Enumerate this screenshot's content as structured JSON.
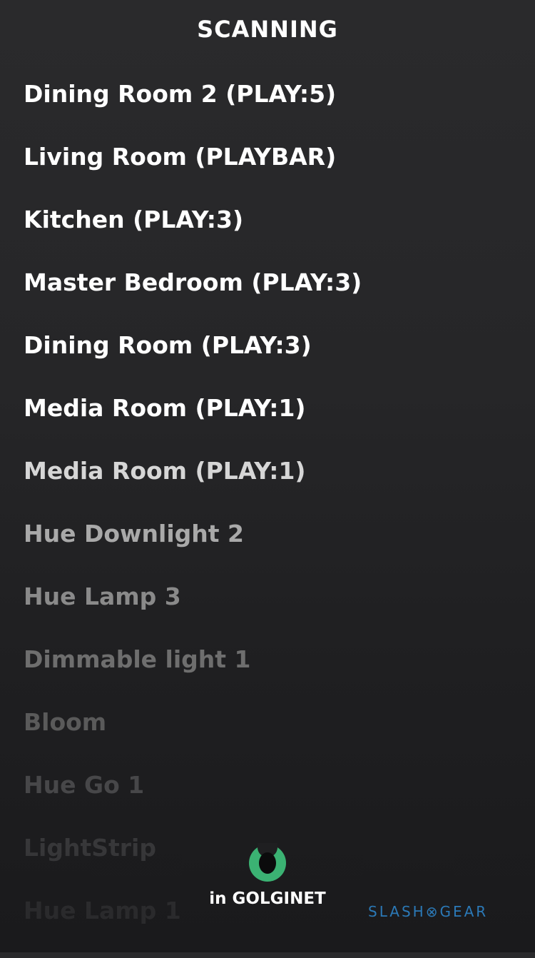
{
  "header": {
    "title": "SCANNING"
  },
  "devices": [
    {
      "label": "Dining Room 2 (PLAY:5)",
      "color": "#ffffff"
    },
    {
      "label": "Living Room (PLAYBAR)",
      "color": "#ffffff"
    },
    {
      "label": "Kitchen (PLAY:3)",
      "color": "#ffffff"
    },
    {
      "label": "Master Bedroom (PLAY:3)",
      "color": "#ffffff"
    },
    {
      "label": "Dining Room (PLAY:3)",
      "color": "#ffffff"
    },
    {
      "label": "Media Room (PLAY:1)",
      "color": "#ffffff"
    },
    {
      "label": "Media Room (PLAY:1)",
      "color": "#d6d6d6"
    },
    {
      "label": "Hue Downlight 2",
      "color": "#a9a9a9"
    },
    {
      "label": "Hue Lamp 3",
      "color": "#8a8a8a"
    },
    {
      "label": "Dimmable light 1",
      "color": "#6e6e6e"
    },
    {
      "label": "Bloom",
      "color": "#5a5a5a"
    },
    {
      "label": "Hue Go 1",
      "color": "#474749"
    },
    {
      "label": "LightStrip",
      "color": "#3a3a3c"
    },
    {
      "label": "Hue Lamp 1",
      "color": "#303032"
    }
  ],
  "status": {
    "spinner_icon": "scanning-spinner-icon",
    "network": "in GOLGINET",
    "accent": "#3bb273"
  },
  "watermark": {
    "left": "SLASH",
    "symbol": "⊗",
    "right": "GEAR",
    "color": "#2b79b7"
  }
}
